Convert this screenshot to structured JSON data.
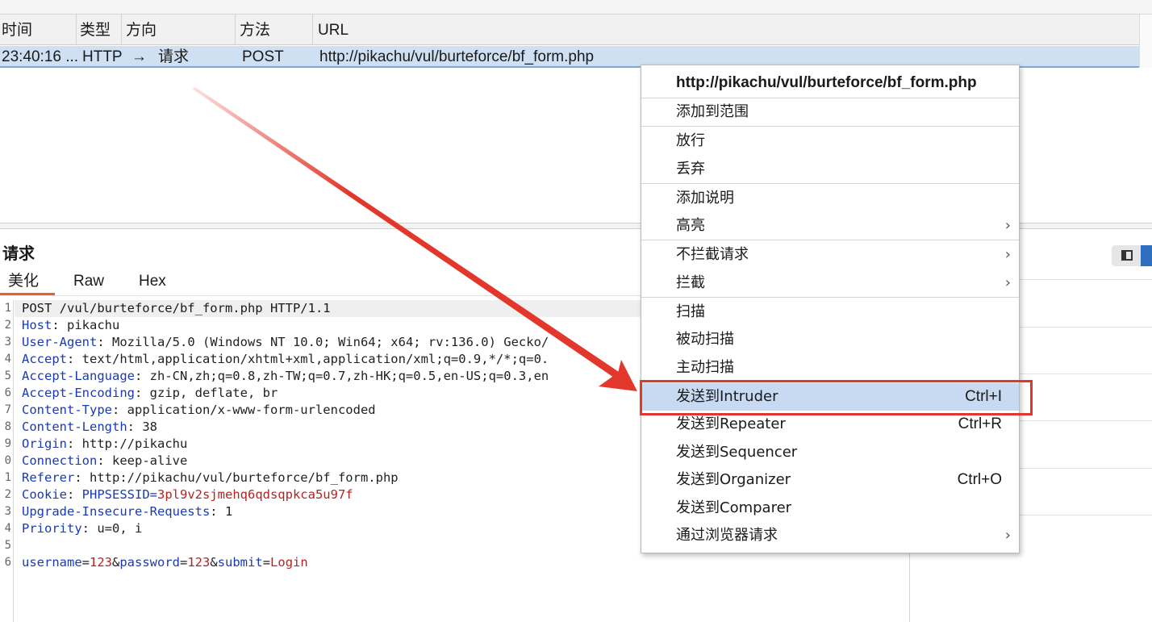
{
  "table": {
    "headers": [
      "时间",
      "类型",
      "方向",
      "方法",
      "URL"
    ],
    "row": {
      "time": "23:40:16 ...",
      "type": "HTTP",
      "direction_arrow": "→",
      "direction": "请求",
      "method": "POST",
      "url": "http://pikachu/vul/burteforce/bf_form.php"
    }
  },
  "request_panel": {
    "title": "请求",
    "tabs": [
      "美化",
      "Raw",
      "Hex"
    ],
    "active_tab": "美化",
    "line_numbers": [
      "1",
      "2",
      "3",
      "4",
      "5",
      "6",
      "7",
      "8",
      "9",
      "0",
      "1",
      "2",
      "3",
      "4",
      "5",
      "6"
    ],
    "lines": [
      {
        "text": "POST /vul/burteforce/bf_form.php HTTP/1.1"
      },
      {
        "key": "Host",
        "sep": ": ",
        "value": "pikachu"
      },
      {
        "key": "User-Agent",
        "sep": ": ",
        "value": "Mozilla/5.0 (Windows NT 10.0; Win64; x64; rv:136.0) Gecko/"
      },
      {
        "key": "Accept",
        "sep": ": ",
        "value": "text/html,application/xhtml+xml,application/xml;q=0.9,*/*;q=0."
      },
      {
        "key": "Accept-Language",
        "sep": ": ",
        "value": "zh-CN,zh;q=0.8,zh-TW;q=0.7,zh-HK;q=0.5,en-US;q=0.3,en"
      },
      {
        "key": "Accept-Encoding",
        "sep": ": ",
        "value": "gzip, deflate, br"
      },
      {
        "key": "Content-Type",
        "sep": ": ",
        "value": "application/x-www-form-urlencoded"
      },
      {
        "key": "Content-Length",
        "sep": ": ",
        "value": "38"
      },
      {
        "key": "Origin",
        "sep": ": ",
        "value": "http://pikachu"
      },
      {
        "key": "Connection",
        "sep": ": ",
        "value": "keep-alive"
      },
      {
        "key": "Referer",
        "sep": ": ",
        "value": "http://pikachu/vul/burteforce/bf_form.php"
      },
      {
        "key": "Cookie",
        "sep": ": ",
        "value": "PHPSESSID=",
        "cookie_value": "3pl9v2sjmehq6qdsqpkca5u97f"
      },
      {
        "key": "Upgrade-Insecure-Requests",
        "sep": ": ",
        "value": "1"
      },
      {
        "key": "Priority",
        "sep": ": ",
        "value": "u=0, i"
      },
      {
        "text": ""
      },
      {
        "body": [
          [
            "username",
            "123"
          ],
          [
            "password",
            "123"
          ],
          [
            "submit",
            "Login"
          ]
        ]
      }
    ]
  },
  "context_menu": {
    "header": "http://pikachu/vul/burteforce/bf_form.php",
    "add_to_scope": "添加到范围",
    "forward": "放行",
    "drop": "丢弃",
    "add_comment": "添加说明",
    "highlight": "高亮",
    "dont_intercept": "不拦截请求",
    "intercept": "拦截",
    "scan": "扫描",
    "passive_scan": "被动扫描",
    "active_scan": "主动扫描",
    "send_intruder": "发送到Intruder",
    "send_intruder_shortcut": "Ctrl+I",
    "send_repeater": "发送到Repeater",
    "send_repeater_shortcut": "Ctrl+R",
    "send_sequencer": "发送到Sequencer",
    "send_organizer": "发送到Organizer",
    "send_organizer_shortcut": "Ctrl+O",
    "send_comparer": "发送到Comparer",
    "request_in_browser": "通过浏览器请求",
    "submenu_chevron": "›"
  },
  "colors": {
    "selected_row": "#cfe0f3",
    "menu_selected": "#c8daf1",
    "annotation_red": "#e4372b",
    "header_key": "#1a3bb1",
    "cookie_value": "#b32420",
    "active_tab_underline": "#e8602c"
  }
}
